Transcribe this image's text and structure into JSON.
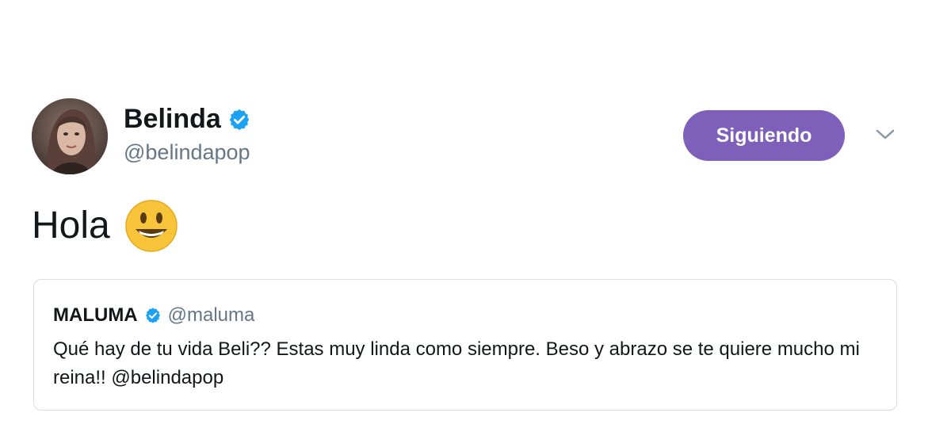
{
  "tweet": {
    "author": {
      "display_name": "Belinda",
      "handle": "@belindapop",
      "verified": true
    },
    "follow_button_label": "Siguiendo",
    "text": "Hola",
    "emoji": "smiling-face-emoji"
  },
  "quoted_tweet": {
    "display_name": "MALUMA",
    "handle": "@maluma",
    "verified": true,
    "text": "Qué hay de tu vida Beli?? Estas muy linda como siempre. Beso y abrazo se te quiere mucho mi reina!! @belindapop"
  },
  "colors": {
    "follow_button": "#7e5fb9",
    "verified_badge": "#1da1f2",
    "secondary_text": "#657786",
    "card_border": "#d6dde3"
  },
  "icons": [
    "verified-icon",
    "chevron-down-icon",
    "smiling-face-emoji"
  ]
}
